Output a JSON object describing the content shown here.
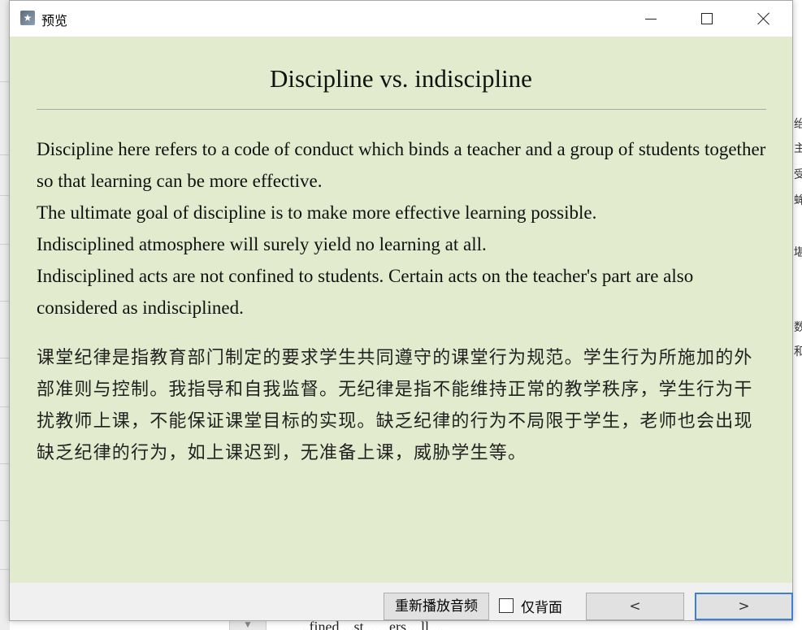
{
  "window": {
    "title": "预览",
    "app_icon": "app-star-icon",
    "minimize_icon": "minimize-icon",
    "maximize_icon": "maximize-icon",
    "close_icon": "close-icon"
  },
  "card": {
    "title": "Discipline vs. indiscipline",
    "english_paragraphs": [
      "Discipline here refers to a code of conduct which binds a teacher and a group of students together so that learning can be more effective.",
      "The ultimate goal of discipline is to make more effective learning possible.",
      "Indisciplined atmosphere will surely yield no learning at all.",
      "Indisciplined acts are not confined to students. Certain acts on the teacher's part are also considered as indisciplined."
    ],
    "chinese_text": "课堂纪律是指教育部门制定的要求学生共同遵守的课堂行为规范。学生行为所施加的外部准则与控制。我指导和自我监督。无纪律是指不能维持正常的教学秩序，学生行为干扰教师上课，不能保证课堂目标的实现。缺乏纪律的行为不局限于学生，老师也会出现缺乏纪律的行为，如上课迟到，无准备上课，威胁学生等。",
    "background_color": "#e2ebcd"
  },
  "toolbar": {
    "replay_label": "重新播放音频",
    "back_only_label": "仅背面",
    "back_only_checked": false,
    "prev_label": "<",
    "next_label": ">",
    "next_focus_color": "#3c7fd4"
  },
  "background_app": {
    "right_glyphs": [
      "绐",
      "主",
      "受",
      "蛑",
      "堪",
      "数",
      "和"
    ],
    "bottom_text": "...fined ...st... ...ers ...ll ..."
  }
}
